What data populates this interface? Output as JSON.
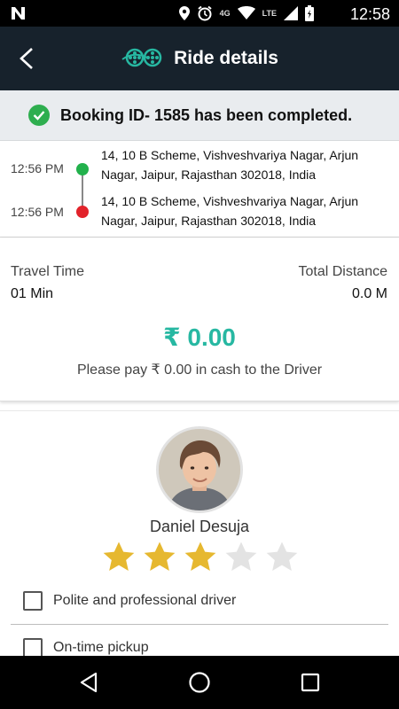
{
  "status_bar": {
    "time": "12:58",
    "network_4g": "4G",
    "network_lte": "LTE",
    "icons": [
      "n-logo-icon",
      "location-icon",
      "alarm-icon",
      "wifi-icon",
      "signal-icon",
      "battery-icon"
    ]
  },
  "header": {
    "title": "Ride details"
  },
  "banner": {
    "message": "Booking ID- 1585 has been completed."
  },
  "route": {
    "pickup": {
      "time": "12:56 PM",
      "address": "14, 10 B Scheme, Vishveshvariya Nagar, Arjun Nagar, Jaipur, Rajasthan 302018, India",
      "color": "#22b14c"
    },
    "dropoff": {
      "time": "12:56 PM",
      "address": "14, 10 B Scheme, Vishveshvariya Nagar, Arjun Nagar, Jaipur, Rajasthan 302018, India",
      "color": "#e2232b"
    }
  },
  "trip": {
    "travel_time_label": "Travel Time",
    "travel_time_value": "01 Min",
    "distance_label": "Total Distance",
    "distance_value": "0.0 M",
    "amount": "₹ 0.00",
    "payment_note": "Please pay ₹ 0.00 in cash to the Driver"
  },
  "driver": {
    "name": "Daniel Desuja",
    "rating": 3,
    "rating_max": 5
  },
  "feedback": [
    {
      "label": "Polite and professional driver",
      "checked": false
    },
    {
      "label": "On-time pickup",
      "checked": false
    }
  ],
  "colors": {
    "appbar": "#17222c",
    "accent_teal": "#27b8a2",
    "star_filled": "#e6b830",
    "star_empty": "#e3e3e3",
    "success": "#2eae4f"
  }
}
